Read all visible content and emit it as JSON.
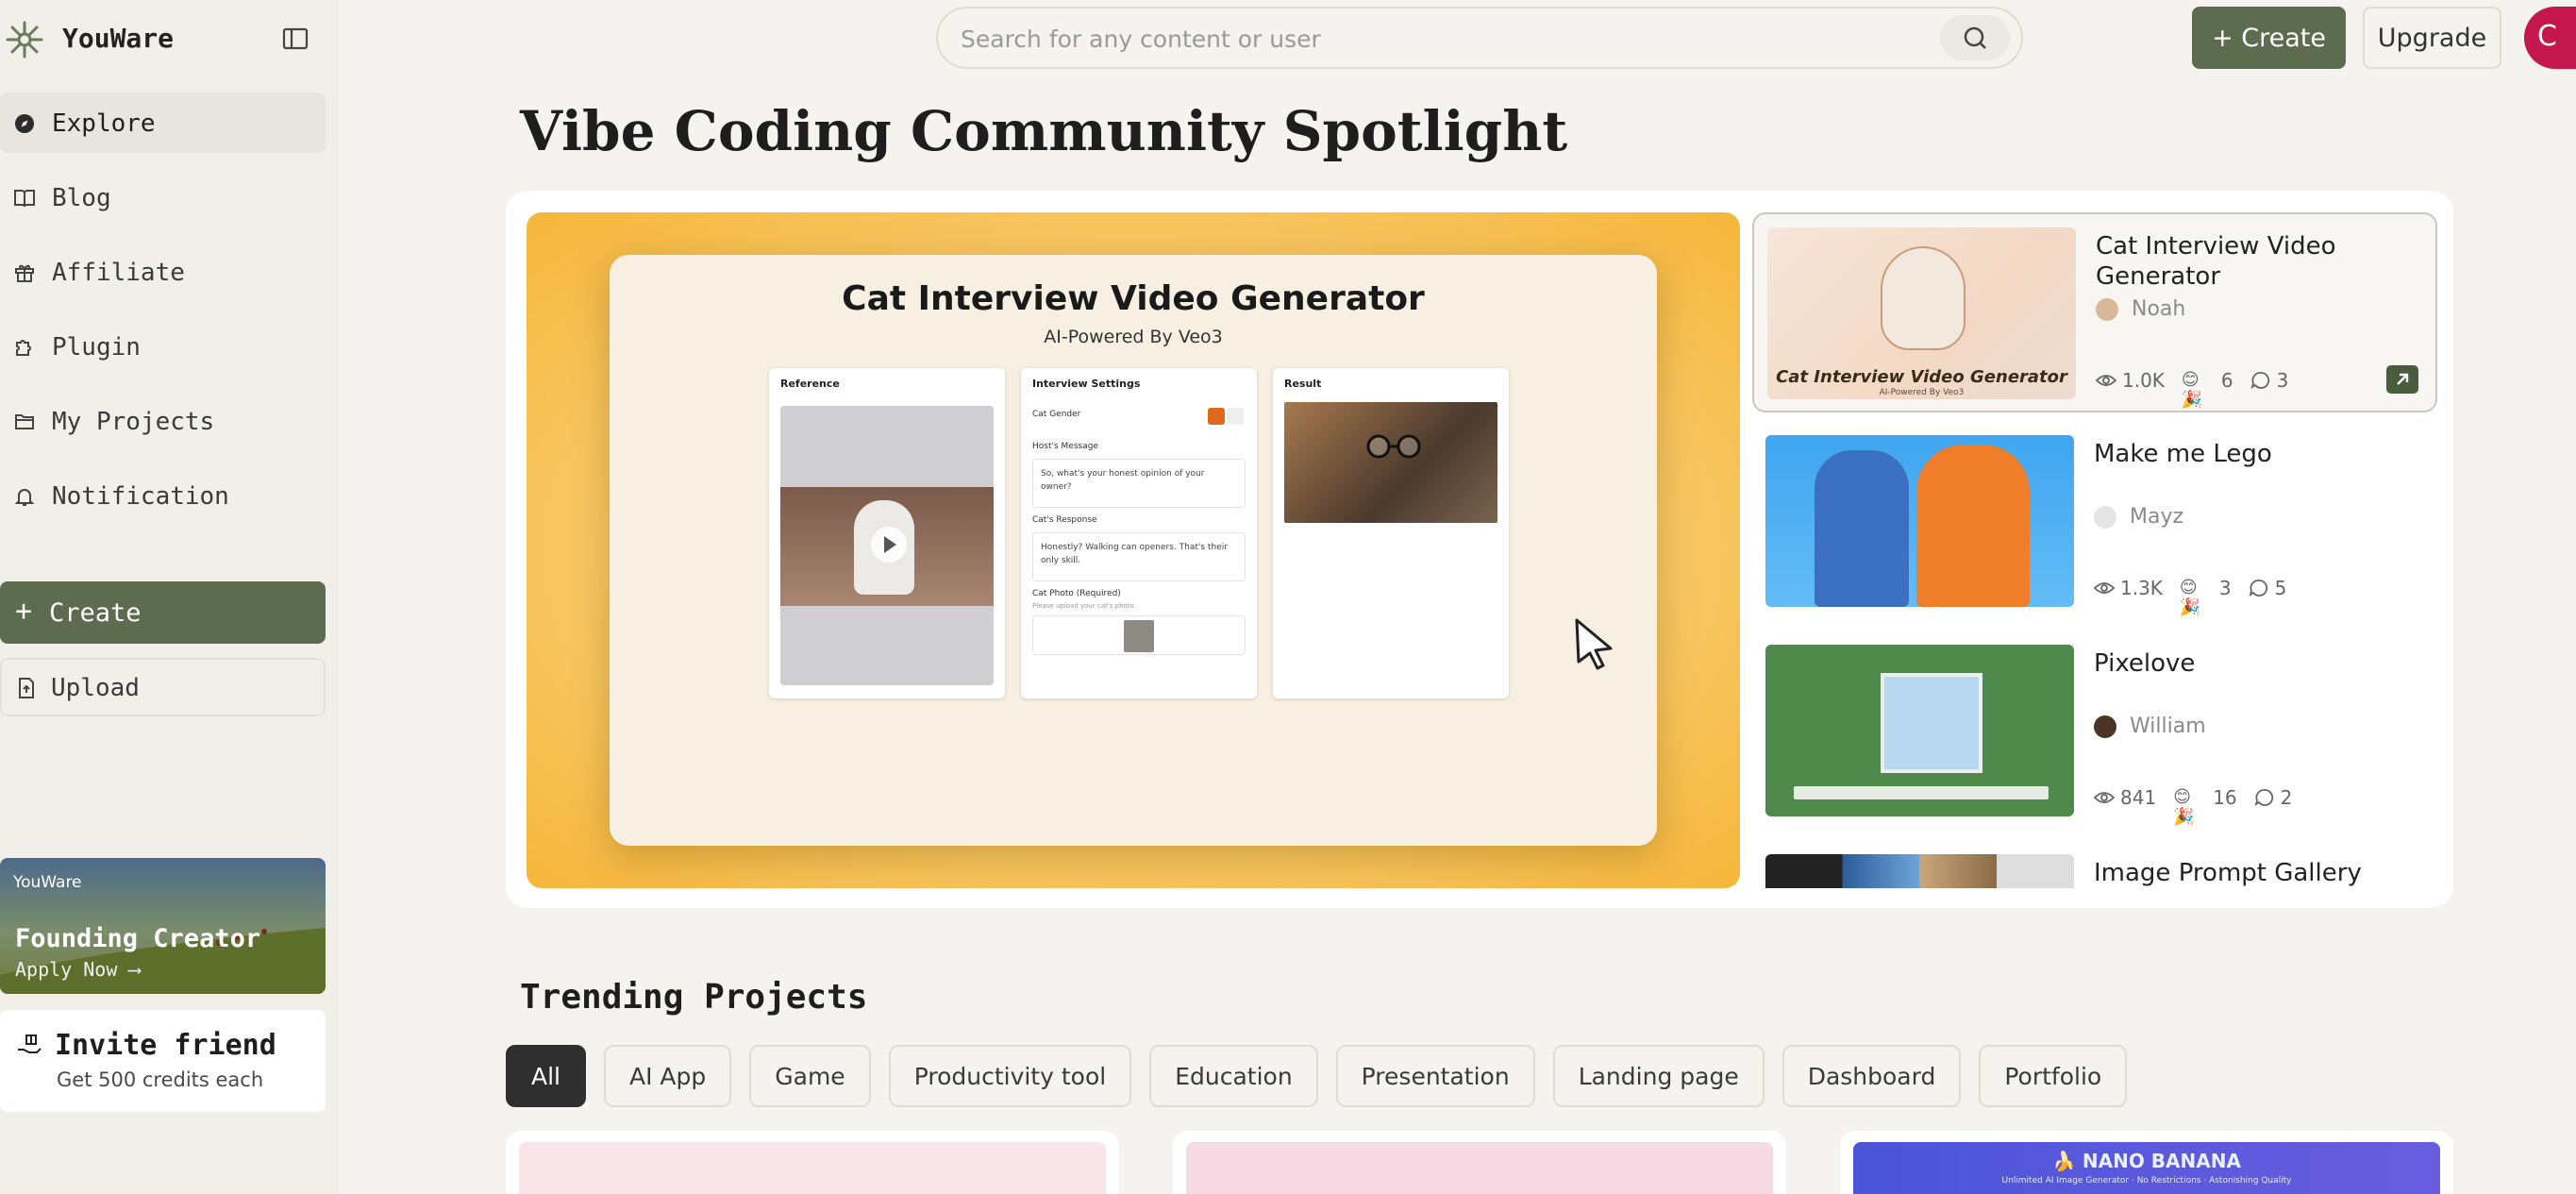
{
  "app": {
    "name": "YouWare"
  },
  "sidebar": {
    "items": [
      {
        "label": "Explore",
        "icon": "compass-icon"
      },
      {
        "label": "Blog",
        "icon": "book-icon"
      },
      {
        "label": "Affiliate",
        "icon": "gift-icon"
      },
      {
        "label": "Plugin",
        "icon": "puzzle-icon"
      },
      {
        "label": "My Projects",
        "icon": "folder-icon"
      },
      {
        "label": "Notification",
        "icon": "bell-icon"
      }
    ],
    "create_label": "Create",
    "upload_label": "Upload",
    "promo": {
      "brand": "YouWare",
      "title": "Founding Creator",
      "cta": "Apply Now  ⟶"
    },
    "invite": {
      "title": "Invite friend",
      "subtitle": "Get 500 credits each"
    }
  },
  "header": {
    "search_placeholder": "Search for any content or user",
    "create_label": "+ Create",
    "upgrade_label": "Upgrade",
    "avatar_initial": "C"
  },
  "spotlight": {
    "title": "Vibe Coding Community Spotlight",
    "hero": {
      "title": "Cat Interview Video Generator",
      "subtitle": "AI-Powered By Veo3",
      "panel_reference": "Reference",
      "panel_settings": "Interview Settings",
      "panel_result": "Result",
      "gender_label": "Cat Gender",
      "host_label": "Host's Message",
      "host_text": "So, what's your honest opinion of your owner?",
      "cat_label": "Cat's Response",
      "cat_text": "Honestly? Walking can openers. That's their only skill.",
      "photo_label": "Cat Photo (Required)",
      "photo_hint": "Please upload your cat's photo"
    },
    "items": [
      {
        "title": "Cat Interview Video Generator",
        "author": "Noah",
        "views": "1.0K",
        "reactions": "6",
        "comments": "3"
      },
      {
        "title": "Make me Lego",
        "author": "Mayz",
        "views": "1.3K",
        "reactions": "3",
        "comments": "5"
      },
      {
        "title": "Pixelove",
        "author": "William",
        "views": "841",
        "reactions": "16",
        "comments": "2"
      },
      {
        "title": "Image Prompt Gallery"
      }
    ],
    "thumb_caption": "Cat Interview Video Generator",
    "thumb_caption_sub": "AI-Powered By Veo3"
  },
  "trending": {
    "title": "Trending Projects",
    "chips": [
      "All",
      "AI App",
      "Game",
      "Productivity tool",
      "Education",
      "Presentation",
      "Landing page",
      "Dashboard",
      "Portfolio"
    ],
    "nano_title": "🍌 NANO BANANA",
    "nano_sub": "Unlimited AI Image Generator · No Restrictions · Astonishing Quality"
  },
  "colors": {
    "accent": "#5d6b4e",
    "avatar": "#c4164f",
    "background": "#f4f3ef"
  }
}
